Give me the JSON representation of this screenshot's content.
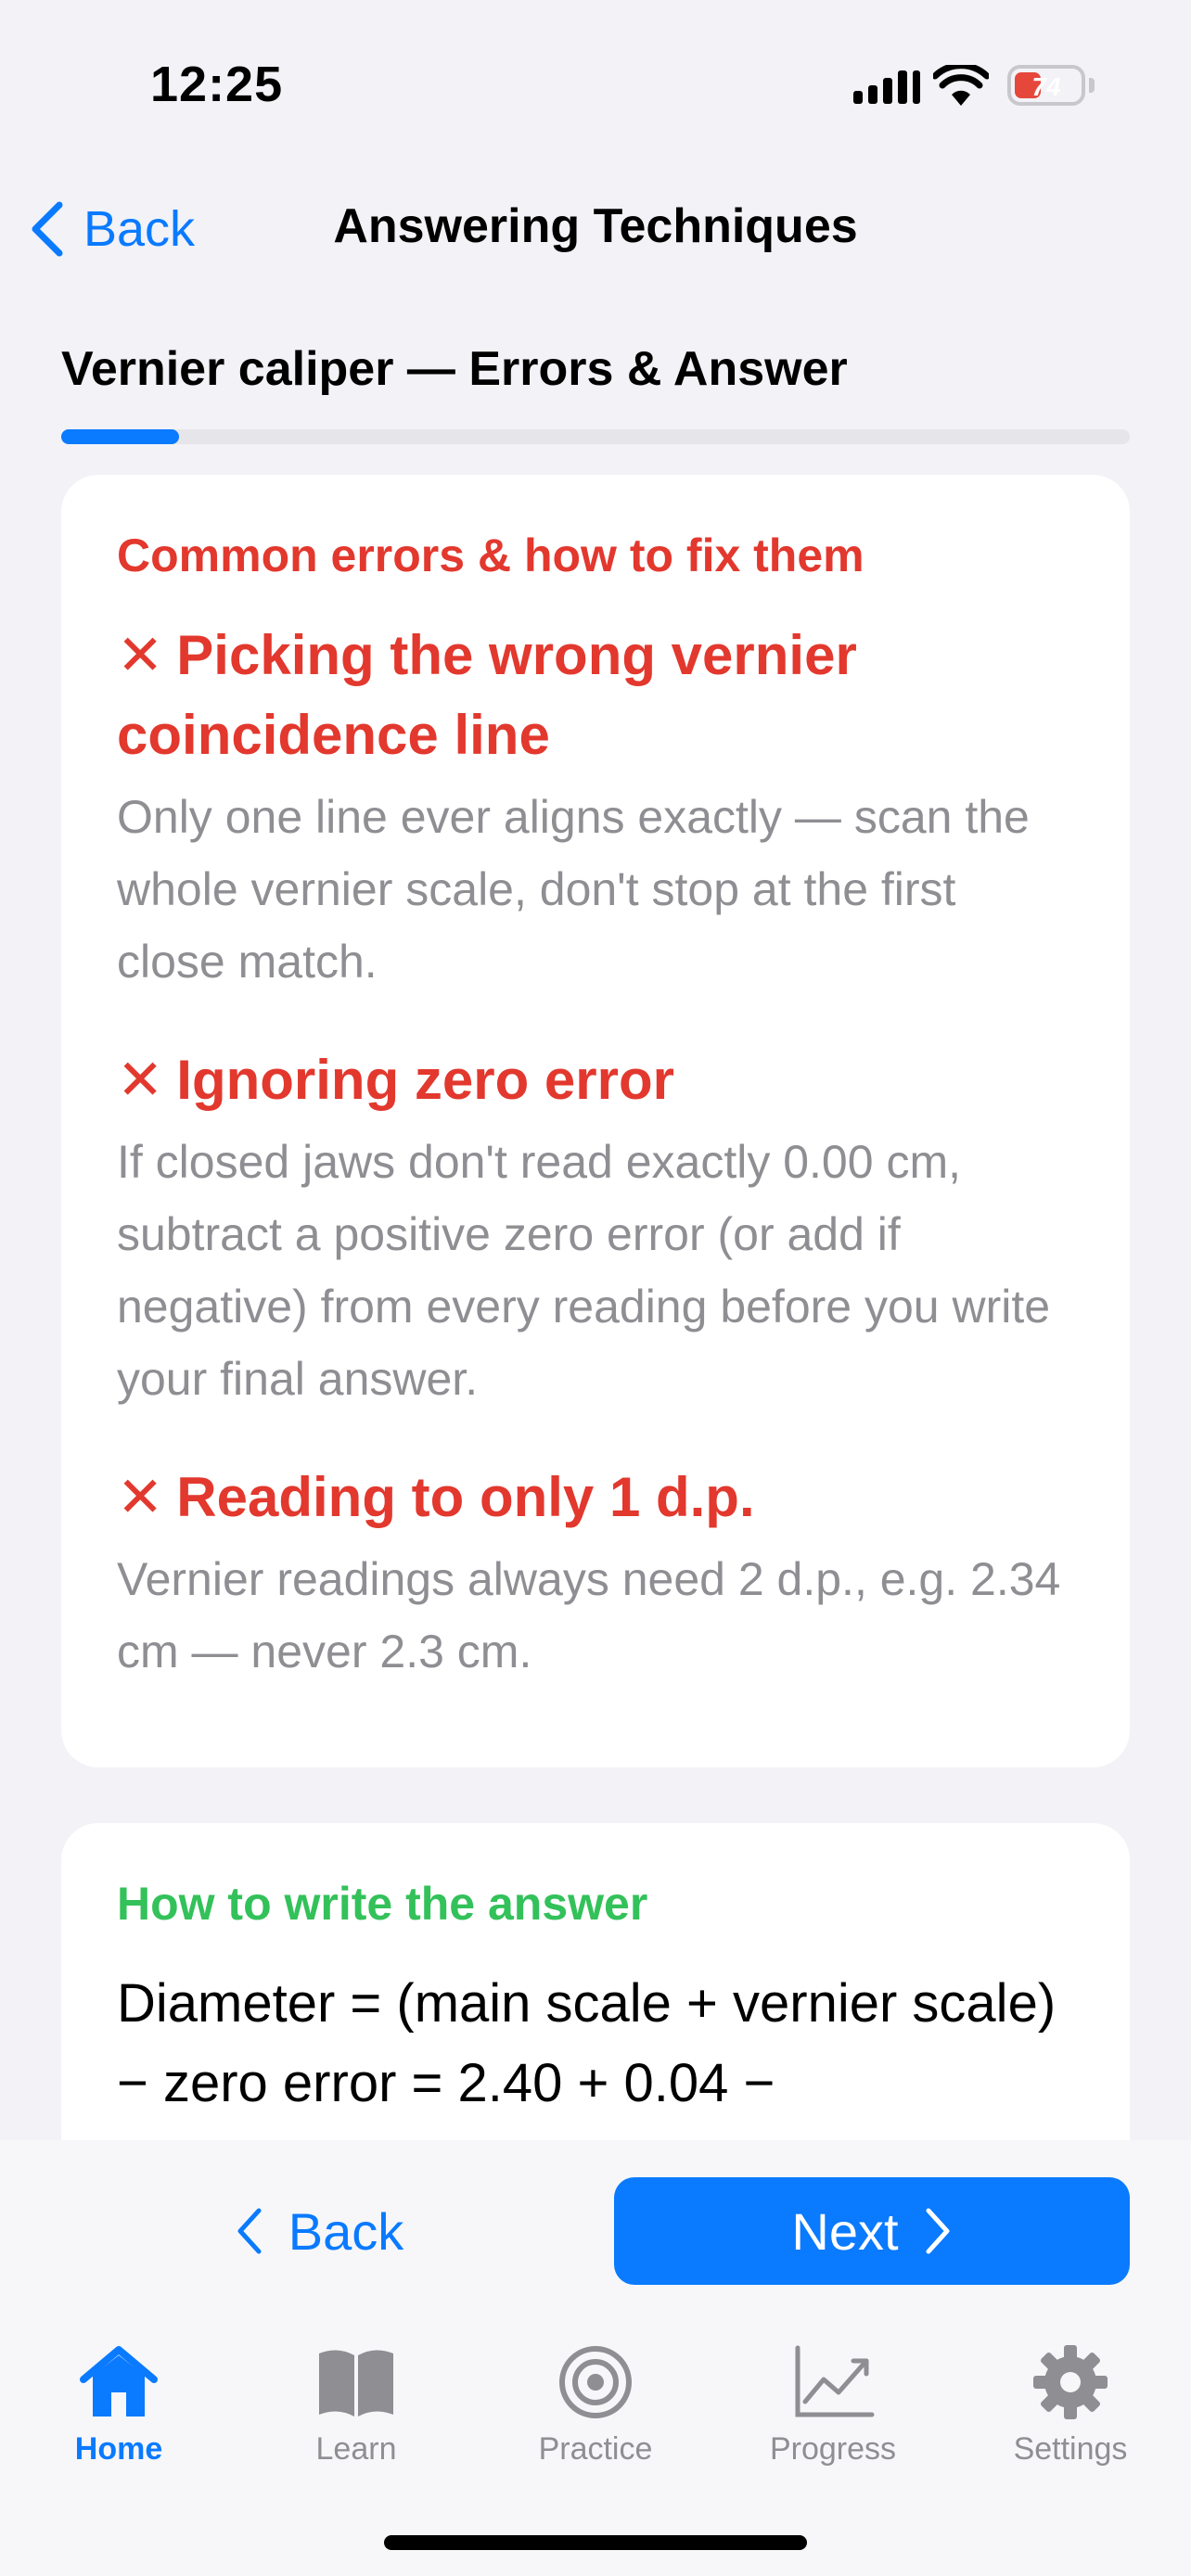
{
  "status_bar": {
    "time": "12:25",
    "battery": "74"
  },
  "nav": {
    "back_label": "Back",
    "title": "Answering Techniques"
  },
  "section": {
    "title": "Vernier caliper — Errors & Answer",
    "progress": 0.11
  },
  "errors_card": {
    "heading": "Common errors & how to fix them",
    "items": [
      {
        "marker": "✕",
        "title": "Picking the wrong vernier coincidence line",
        "body": "Only one line ever aligns exactly — scan the whole vernier scale, don't stop at the first close match."
      },
      {
        "marker": "✕",
        "title": "Ignoring zero error",
        "body": "If closed jaws don't read exactly 0.00 cm, subtract a positive zero error (or add if negative) from every reading before you write your final answer."
      },
      {
        "marker": "✕",
        "title": "Reading to only 1 d.p.",
        "body": "Vernier readings always need 2 d.p., e.g. 2.34 cm — never 2.3 cm."
      }
    ]
  },
  "answer_card": {
    "heading": "How to write the answer",
    "text": "Diameter = (main scale + vernier scale) − zero error = 2.40 + 0.04 −"
  },
  "actions": {
    "back_label": "Back",
    "next_label": "Next"
  },
  "tabbar": {
    "tabs": [
      {
        "label": "Home",
        "icon": "house-icon",
        "active": true
      },
      {
        "label": "Learn",
        "icon": "book-icon",
        "active": false
      },
      {
        "label": "Practice",
        "icon": "target-icon",
        "active": false
      },
      {
        "label": "Progress",
        "icon": "chart-line-icon",
        "active": false
      },
      {
        "label": "Settings",
        "icon": "gear-icon",
        "active": false
      }
    ]
  },
  "colors": {
    "accent": "#0a7aff",
    "error": "#e2382e",
    "success": "#33c15a"
  }
}
